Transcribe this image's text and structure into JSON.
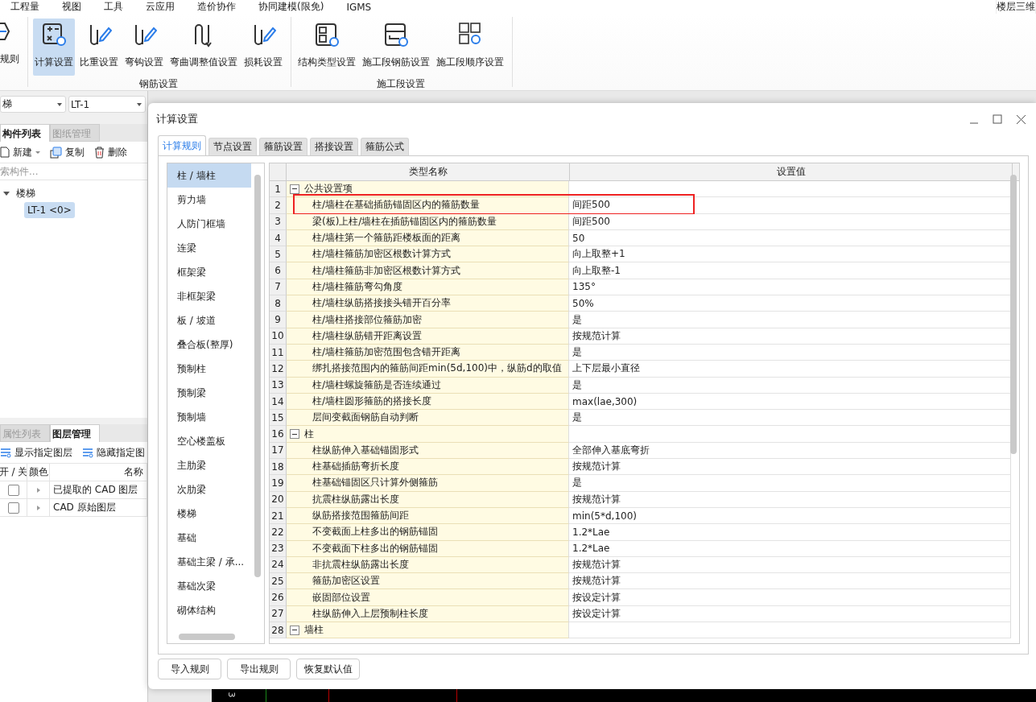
{
  "menu": [
    "工程量",
    "视图",
    "工具",
    "云应用",
    "造价协作",
    "协同建模(限免)",
    "IGMS"
  ],
  "top_right_label": "楼层三维",
  "ribbon": {
    "leading_item": "规则",
    "groups": [
      {
        "label": "钢筋设置",
        "items": [
          {
            "label": "计算设置",
            "selected": true
          },
          {
            "label": "比重设置",
            "selected": false
          },
          {
            "label": "弯钩设置",
            "selected": false
          },
          {
            "label": "弯曲调整值设置",
            "selected": false
          },
          {
            "label": "损耗设置",
            "selected": false
          }
        ]
      },
      {
        "label": "施工段设置",
        "items": [
          {
            "label": "结构类型设置",
            "selected": false
          },
          {
            "label": "施工段钢筋设置",
            "selected": false
          },
          {
            "label": "施工段顺序设置",
            "selected": false
          }
        ]
      }
    ]
  },
  "selectors": [
    "梯",
    "LT-1"
  ],
  "component_panel": {
    "tabs": [
      {
        "label": "构件列表",
        "selected": true
      },
      {
        "label": "图纸管理",
        "selected": false
      }
    ],
    "toolbar": [
      "新建",
      "复制",
      "删除"
    ],
    "search": {
      "placeholder": "索构件..."
    },
    "tree": [
      {
        "label": "楼梯",
        "expanded": true,
        "selected": false,
        "children": [
          {
            "label": "LT-1  <0>",
            "selected": true
          }
        ]
      }
    ]
  },
  "layer_panel": {
    "tabs": [
      {
        "label": "属性列表",
        "selected": false
      },
      {
        "label": "图层管理",
        "selected": true
      }
    ],
    "toolbar": [
      "显示指定图层",
      "隐藏指定图"
    ],
    "columns": [
      "开 / 关",
      "颜色",
      "名称"
    ],
    "rows": [
      {
        "checked": false,
        "name": "已提取的 CAD 图层"
      },
      {
        "checked": false,
        "name": "CAD 原始图层"
      }
    ]
  },
  "canvas": {
    "axis_label": "3"
  },
  "dialog": {
    "title": "计算设置",
    "tabs": [
      {
        "label": "计算规则",
        "selected": true
      },
      {
        "label": "节点设置",
        "selected": false
      },
      {
        "label": "箍筋设置",
        "selected": false
      },
      {
        "label": "搭接设置",
        "selected": false
      },
      {
        "label": "箍筋公式",
        "selected": false
      }
    ],
    "categories": [
      {
        "label": "柱 / 墙柱",
        "selected": true
      },
      {
        "label": "剪力墙",
        "selected": false
      },
      {
        "label": "人防门框墙",
        "selected": false
      },
      {
        "label": "连梁",
        "selected": false
      },
      {
        "label": "框架梁",
        "selected": false
      },
      {
        "label": "非框架梁",
        "selected": false
      },
      {
        "label": "板 / 坡道",
        "selected": false
      },
      {
        "label": "叠合板(整厚)",
        "selected": false
      },
      {
        "label": "预制柱",
        "selected": false
      },
      {
        "label": "预制梁",
        "selected": false
      },
      {
        "label": "预制墙",
        "selected": false
      },
      {
        "label": "空心楼盖板",
        "selected": false
      },
      {
        "label": "主肋梁",
        "selected": false
      },
      {
        "label": "次肋梁",
        "selected": false
      },
      {
        "label": "楼梯",
        "selected": false
      },
      {
        "label": "基础",
        "selected": false
      },
      {
        "label": "基础主梁 / 承...",
        "selected": false
      },
      {
        "label": "基础次梁",
        "selected": false
      },
      {
        "label": "砌体结构",
        "selected": false
      }
    ],
    "table": {
      "columns": [
        "类型名称",
        "设置值"
      ],
      "rows": [
        {
          "number": "1",
          "kind": "group",
          "name": "公共设置项",
          "expanded": true,
          "highlighted": false
        },
        {
          "number": "2",
          "kind": "item",
          "name": "柱/墙柱在基础插筋锚固区内的箍筋数量",
          "value": "间距500",
          "highlighted": true
        },
        {
          "number": "3",
          "kind": "item",
          "name": "梁(板)上柱/墙柱在插筋锚固区内的箍筋数量",
          "value": "间距500",
          "highlighted": false
        },
        {
          "number": "4",
          "kind": "item",
          "name": "柱/墙柱第一个箍筋距楼板面的距离",
          "value": "50",
          "highlighted": false
        },
        {
          "number": "5",
          "kind": "item",
          "name": "柱/墙柱箍筋加密区根数计算方式",
          "value": "向上取整+1",
          "highlighted": false
        },
        {
          "number": "6",
          "kind": "item",
          "name": "柱/墙柱箍筋非加密区根数计算方式",
          "value": "向上取整-1",
          "highlighted": false
        },
        {
          "number": "7",
          "kind": "item",
          "name": "柱/墙柱箍筋弯勾角度",
          "value": "135°",
          "highlighted": false
        },
        {
          "number": "8",
          "kind": "item",
          "name": "柱/墙柱纵筋搭接接头错开百分率",
          "value": "50%",
          "highlighted": false
        },
        {
          "number": "9",
          "kind": "item",
          "name": "柱/墙柱搭接部位箍筋加密",
          "value": "是",
          "highlighted": false
        },
        {
          "number": "10",
          "kind": "item",
          "name": "柱/墙柱纵筋错开距离设置",
          "value": "按规范计算",
          "highlighted": false
        },
        {
          "number": "11",
          "kind": "item",
          "name": "柱/墙柱箍筋加密范围包含错开距离",
          "value": "是",
          "highlighted": false
        },
        {
          "number": "12",
          "kind": "item",
          "name": "绑扎搭接范围内的箍筋间距min(5d,100)中，纵筋d的取值",
          "value": "上下层最小直径",
          "highlighted": false
        },
        {
          "number": "13",
          "kind": "item",
          "name": "柱/墙柱螺旋箍筋是否连续通过",
          "value": "是",
          "highlighted": false
        },
        {
          "number": "14",
          "kind": "item",
          "name": "柱/墙柱圆形箍筋的搭接长度",
          "value": "max(lae,300)",
          "highlighted": false
        },
        {
          "number": "15",
          "kind": "item",
          "name": "层间变截面钢筋自动判断",
          "value": "是",
          "highlighted": false
        },
        {
          "number": "16",
          "kind": "group",
          "name": "柱",
          "expanded": true,
          "highlighted": false
        },
        {
          "number": "17",
          "kind": "item",
          "name": "柱纵筋伸入基础锚固形式",
          "value": "全部伸入基底弯折",
          "highlighted": false
        },
        {
          "number": "18",
          "kind": "item",
          "name": "柱基础插筋弯折长度",
          "value": "按规范计算",
          "highlighted": false
        },
        {
          "number": "19",
          "kind": "item",
          "name": "柱基础锚固区只计算外侧箍筋",
          "value": "是",
          "highlighted": false
        },
        {
          "number": "20",
          "kind": "item",
          "name": "抗震柱纵筋露出长度",
          "value": "按规范计算",
          "highlighted": false
        },
        {
          "number": "21",
          "kind": "item",
          "name": "纵筋搭接范围箍筋间距",
          "value": "min(5*d,100)",
          "highlighted": false
        },
        {
          "number": "22",
          "kind": "item",
          "name": "不变截面上柱多出的钢筋锚固",
          "value": "1.2*Lae",
          "highlighted": false
        },
        {
          "number": "23",
          "kind": "item",
          "name": "不变截面下柱多出的钢筋锚固",
          "value": "1.2*Lae",
          "highlighted": false
        },
        {
          "number": "24",
          "kind": "item",
          "name": "非抗震柱纵筋露出长度",
          "value": "按规范计算",
          "highlighted": false
        },
        {
          "number": "25",
          "kind": "item",
          "name": "箍筋加密区设置",
          "value": "按规范计算",
          "highlighted": false
        },
        {
          "number": "26",
          "kind": "item",
          "name": "嵌固部位设置",
          "value": "按设定计算",
          "highlighted": false
        },
        {
          "number": "27",
          "kind": "item",
          "name": "柱纵筋伸入上层预制柱长度",
          "value": "按设定计算",
          "highlighted": false
        },
        {
          "number": "28",
          "kind": "group",
          "name": "墙柱",
          "expanded": true,
          "highlighted": false
        }
      ]
    },
    "buttons": [
      "导入规则",
      "导出规则",
      "恢复默认值"
    ]
  }
}
